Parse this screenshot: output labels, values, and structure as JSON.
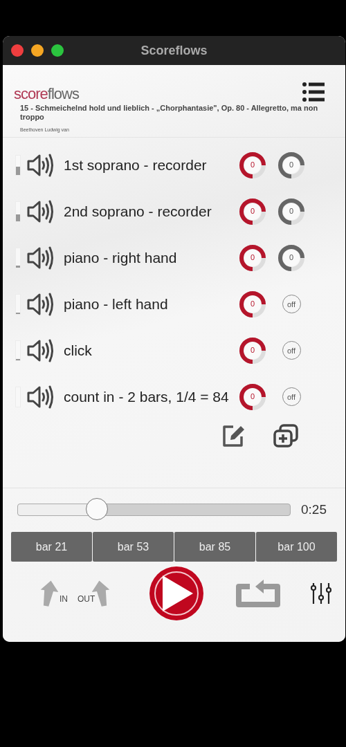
{
  "window": {
    "title": "Scoreflows"
  },
  "header": {
    "logo": {
      "accent": "score",
      "rest": "flows"
    },
    "piece_title": "15 - Schmeichelnd hold und lieblich - „Chorphantasie\", Op. 80 - Allegretto, ma non troppo",
    "composer": "Beethoven Ludwig van"
  },
  "tracks": [
    {
      "name": "1st soprano - recorder",
      "level": 0.4,
      "knob_1": "0",
      "control_2": {
        "kind": "knob",
        "label": "0"
      }
    },
    {
      "name": "2nd soprano - recorder",
      "level": 0.35,
      "knob_1": "0",
      "control_2": {
        "kind": "knob",
        "label": "0"
      }
    },
    {
      "name": "piano - right hand",
      "level": 0.1,
      "knob_1": "0",
      "control_2": {
        "kind": "knob",
        "label": "0"
      }
    },
    {
      "name": "piano - left hand",
      "level": 0.05,
      "knob_1": "0",
      "control_2": {
        "kind": "toggle",
        "label": "off"
      }
    },
    {
      "name": "click",
      "level": 0.05,
      "knob_1": "0",
      "control_2": {
        "kind": "toggle",
        "label": "off"
      }
    },
    {
      "name": "count in - 2 bars, 1/4 = 84",
      "level": 0,
      "knob_1": "0",
      "control_2": {
        "kind": "toggle",
        "label": "off"
      }
    }
  ],
  "position": {
    "level": 0.29,
    "time": "0:25"
  },
  "bar_buttons": [
    "bar 21",
    "bar 53",
    "bar 85",
    "bar 100"
  ],
  "markers": {
    "in": "IN",
    "out": "OUT"
  }
}
